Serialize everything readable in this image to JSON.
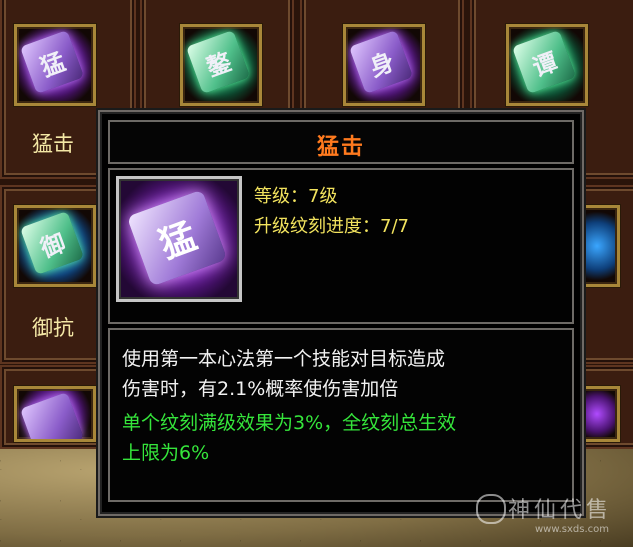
{
  "skill_grid": {
    "cells": [
      {
        "label": "猛击",
        "glyph": "猛",
        "color": "purple"
      },
      {
        "label": "",
        "glyph": "鏊",
        "color": "green"
      },
      {
        "label": "",
        "glyph": "身",
        "color": "purple"
      },
      {
        "label": "",
        "glyph": "谭",
        "color": "green"
      },
      {
        "label": "御抗",
        "glyph": "御",
        "color": "green"
      },
      {
        "label": "",
        "glyph": "",
        "color": "purple"
      }
    ]
  },
  "tooltip": {
    "title": "猛击",
    "icon": {
      "glyph": "猛",
      "name": "mengji-skill-icon"
    },
    "level_text": "等级：7级",
    "progress_text": "升级纹刻进度：7/7",
    "description_lines": [
      "使用第一本心法第一个技能对目标造成",
      "伤害时，有2.1%概率使伤害加倍"
    ],
    "bonus_lines": [
      "单个纹刻满级效果为3%，全纹刻总生效",
      "上限为6%"
    ]
  },
  "watermark": {
    "text": "神仙代售",
    "url": "www.sxds.com"
  },
  "colors": {
    "title": "#ff7a1e",
    "stat": "#f2e35e",
    "description": "#f2f2f2",
    "bonus": "#35e53b",
    "label": "#f4e8a6"
  }
}
